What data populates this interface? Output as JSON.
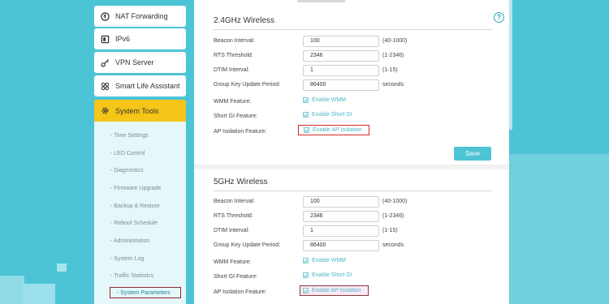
{
  "sidebar": {
    "menu": [
      {
        "label": "NAT Forwarding",
        "icon": "nat-forwarding-icon"
      },
      {
        "label": "IPv6",
        "icon": "ipv6-icon"
      },
      {
        "label": "VPN Server",
        "icon": "vpn-key-icon"
      },
      {
        "label": "Smart Life Assistant",
        "icon": "smart-life-icon"
      },
      {
        "label": "System Tools",
        "icon": "gear-icon"
      }
    ],
    "submenu": [
      "- Time Settings",
      "- LED Control",
      "- Diagnostics",
      "- Firmware Upgrade",
      "- Backup & Restore",
      "- Reboot Schedule",
      "- Administration",
      "- System Log",
      "- Traffic Statistics",
      "- System Parameters"
    ],
    "current": "- System Parameters"
  },
  "main": {
    "help": "?",
    "sections": [
      {
        "title": "2.4GHz Wireless",
        "beacon_label": "Beacon Interval:",
        "beacon_value": "100",
        "beacon_range": "(40-1000)",
        "rts_label": "RTS Threshold:",
        "rts_value": "2346",
        "rts_range": "(1-2346)",
        "dtim_label": "DTIM Interval:",
        "dtim_value": "1",
        "dtim_range": "(1-15)",
        "gk_label": "Group Key Update Period:",
        "gk_value": "86400",
        "gk_unit": "seconds",
        "wmm_label": "WMM Feature:",
        "wmm_check": "Enable WMM",
        "sgi_label": "Short GI Feature:",
        "sgi_check": "Enable Short GI",
        "api_label": "AP Isolation Feature:",
        "api_check": "Enable AP Isolation"
      },
      {
        "title": "5GHz Wireless",
        "beacon_label": "Beacon Interval:",
        "beacon_value": "100",
        "beacon_range": "(40-1000)",
        "rts_label": "RTS Threshold:",
        "rts_value": "2346",
        "rts_range": "(1-2346)",
        "dtim_label": "DTIM Interval:",
        "dtim_value": "1",
        "dtim_range": "(1-15)",
        "gk_label": "Group Key Update Period:",
        "gk_value": "86400",
        "gk_unit": "seconds",
        "wmm_label": "WMM Feature:",
        "wmm_check": "Enable WMM",
        "sgi_label": "Short GI Feature:",
        "sgi_check": "Enable Short GI",
        "api_label": "AP Isolation Feature:",
        "api_check": "Enable AP Isolation"
      }
    ],
    "save_label": "Save"
  },
  "colors": {
    "background": "#4cc4d6",
    "accent": "#4cc4d6",
    "active_menu": "#f5c518",
    "highlight_box": "#d92a2a"
  }
}
